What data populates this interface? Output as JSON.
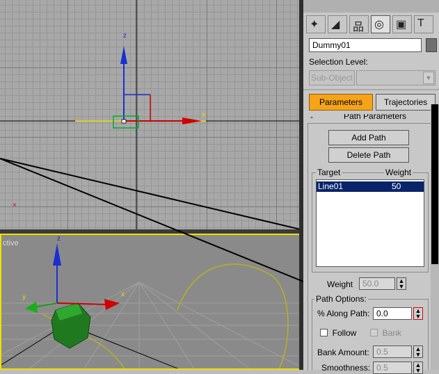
{
  "viewports": {
    "top": {
      "axis_z": "z",
      "axis_x": "x"
    },
    "perspective": {
      "label": "ctive",
      "axis_z": "z",
      "axis_x": "x",
      "axis_y": "y"
    }
  },
  "panel": {
    "tabs": [
      {
        "name": "create-tab",
        "glyph": "✦"
      },
      {
        "name": "modify-tab",
        "glyph": "◢"
      },
      {
        "name": "hierarchy-tab",
        "glyph": "品"
      },
      {
        "name": "motion-tab",
        "glyph": "◎"
      },
      {
        "name": "display-tab",
        "glyph": "▣"
      },
      {
        "name": "utilities-tab",
        "glyph": "T"
      }
    ],
    "object_name": "Dummy01",
    "color_swatch": "#707070",
    "selection_level_label": "Selection Level:",
    "sub_object_label": "Sub-Object",
    "parameters_label": "Parameters",
    "trajectories_label": "Trajectories",
    "rollout_toggle": "-",
    "rollout_title": "Path Parameters",
    "add_path_label": "Add Path",
    "delete_path_label": "Delete Path",
    "target_header": "Target",
    "weight_header": "Weight",
    "targets": [
      {
        "target": "Line01",
        "weight": "50"
      }
    ],
    "weight_label": "Weight",
    "weight_value": "50.0",
    "path_options_title": "Path Options:",
    "along_path_label": "% Along Path:",
    "along_path_value": "0.0",
    "follow_label": "Follow",
    "bank_label": "Bank",
    "bank_amount_label": "Bank Amount:",
    "bank_amount_value": "0.5",
    "smoothness_label": "Smoothness:",
    "smoothness_value": "0.5"
  }
}
